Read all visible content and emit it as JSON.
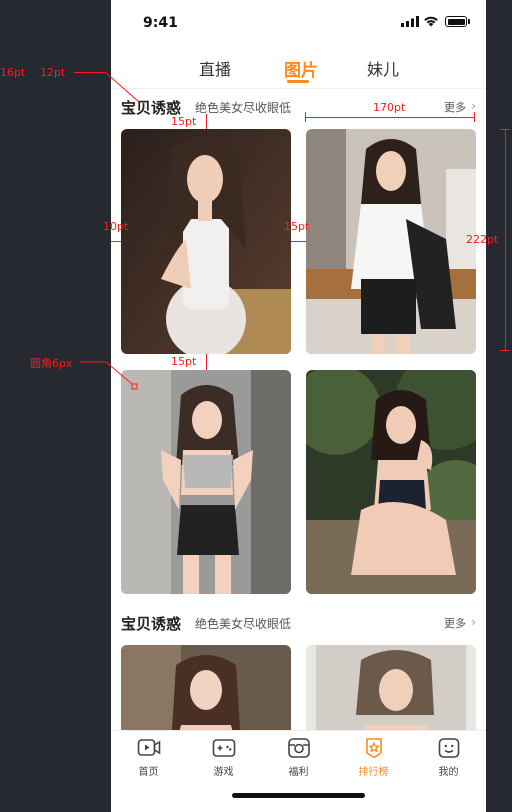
{
  "status_bar": {
    "time": "9:41"
  },
  "top_tabs": [
    {
      "label": "直播",
      "active": false
    },
    {
      "label": "图片",
      "active": true
    },
    {
      "label": "妹儿",
      "active": false
    }
  ],
  "sections": [
    {
      "title": "宝贝诱惑",
      "subtitle": "绝色美女尽收眼低",
      "more": "更多"
    },
    {
      "title": "宝贝诱惑",
      "subtitle": "绝色美女尽收眼低",
      "more": "更多"
    }
  ],
  "tab_bar": {
    "items": [
      {
        "label": "首页",
        "icon": "video-icon",
        "active": false
      },
      {
        "label": "游戏",
        "icon": "gamepad-icon",
        "active": false
      },
      {
        "label": "福利",
        "icon": "gift-icon",
        "active": false
      },
      {
        "label": "排行榜",
        "icon": "ranking-icon",
        "active": true
      },
      {
        "label": "我的",
        "icon": "profile-icon",
        "active": false
      }
    ]
  },
  "annotations": {
    "margin_left": "16pt",
    "margin_top": "12pt",
    "gap_title": "15pt",
    "card_width": "170pt",
    "side_padding": "10pt",
    "col_gap": "15pt",
    "card_height": "222pt",
    "row_gap": "15pt",
    "corner_radius": "圆角6px"
  },
  "colors": {
    "accent": "#ff8a1c",
    "annotation": "#ff1a1a",
    "backdrop": "#262a30"
  }
}
